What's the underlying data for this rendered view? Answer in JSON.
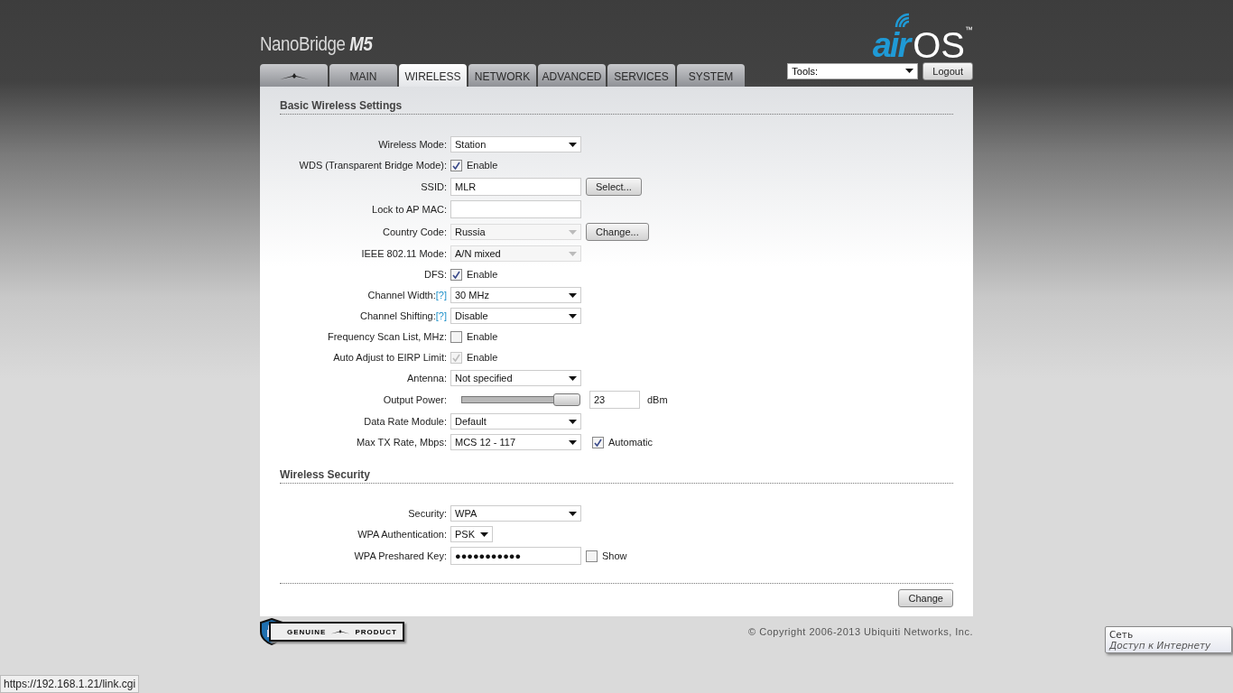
{
  "header": {
    "product": "NanoBridge",
    "model": "M5",
    "logo_air": "air",
    "logo_os": "OS",
    "logo_tm": "™"
  },
  "tabs": [
    {
      "kind": "logo",
      "selected": false
    },
    {
      "kind": "text",
      "label": "MAIN",
      "selected": false
    },
    {
      "kind": "text",
      "label": "WIRELESS",
      "selected": true
    },
    {
      "kind": "text",
      "label": "NETWORK",
      "selected": false
    },
    {
      "kind": "text",
      "label": "ADVANCED",
      "selected": false
    },
    {
      "kind": "text",
      "label": "SERVICES",
      "selected": false
    },
    {
      "kind": "text",
      "label": "SYSTEM",
      "selected": false
    }
  ],
  "tools": {
    "value": "Tools:"
  },
  "logout": "Logout",
  "sections": [
    {
      "title": "Basic Wireless Settings",
      "rows": [
        {
          "kind": "select",
          "label": "Wireless Mode:",
          "value": "Station",
          "disabled": false
        },
        {
          "kind": "checkbox",
          "label": "WDS (Transparent Bridge Mode):",
          "checkbox_label": "Enable",
          "checked": true,
          "disabled": false
        },
        {
          "kind": "text_button",
          "label": "SSID:",
          "value": "MLR",
          "button": "Select..."
        },
        {
          "kind": "text",
          "label": "Lock to AP MAC:"
        },
        {
          "kind": "select_button",
          "label": "Country Code:",
          "value": "Russia",
          "disabled": true,
          "button": "Change..."
        },
        {
          "kind": "select",
          "label": "IEEE 802.11 Mode:",
          "value": "A/N mixed",
          "disabled": true
        },
        {
          "kind": "checkbox",
          "label": "DFS:",
          "checkbox_label": "Enable",
          "checked": true,
          "disabled": false
        },
        {
          "kind": "select",
          "label": "Channel Width:",
          "help": "[?]",
          "value": "30 MHz",
          "disabled": false
        },
        {
          "kind": "select",
          "label": "Channel Shifting:",
          "help": "[?]",
          "value": "Disable",
          "disabled": false
        },
        {
          "kind": "checkbox",
          "label": "Frequency Scan List, MHz:",
          "checkbox_label": "Enable",
          "checked": false,
          "disabled": false
        },
        {
          "kind": "checkbox",
          "label": "Auto Adjust to EIRP Limit:",
          "checkbox_label": "Enable",
          "checked": true,
          "disabled": true
        },
        {
          "kind": "select",
          "label": "Antenna:",
          "value": "Not specified",
          "disabled": false
        },
        {
          "kind": "slider",
          "label": "Output Power:",
          "level": 1,
          "value": "23",
          "unit": "dBm"
        },
        {
          "kind": "select",
          "label": "Data Rate Module:",
          "value": "Default",
          "disabled": false
        },
        {
          "kind": "select_checkbox",
          "label": "Max TX Rate, Mbps:",
          "value": "MCS 12 - 117",
          "disabled": false,
          "checkbox_label": "Automatic",
          "checked": true
        }
      ]
    },
    {
      "title": "Wireless Security",
      "rows": [
        {
          "kind": "select",
          "label": "Security:",
          "value": "WPA",
          "disabled": false
        },
        {
          "kind": "select_small",
          "label": "WPA Authentication:",
          "value": "PSK",
          "disabled": false
        },
        {
          "kind": "password_checkbox",
          "label": "WPA Preshared Key:",
          "value": "●●●●●●●●●●●",
          "checkbox_label": "Show",
          "checked": false
        }
      ]
    }
  ],
  "change_button": "Change",
  "badge": {
    "left": "GENUINE",
    "right": "PRODUCT"
  },
  "copyright": "© Copyright 2006-2013 Ubiquiti Networks, Inc.",
  "tooltip": {
    "title": "Сеть",
    "subtitle": "Доступ к Интернету"
  },
  "status_url": "https://192.168.1.21/link.cgi"
}
